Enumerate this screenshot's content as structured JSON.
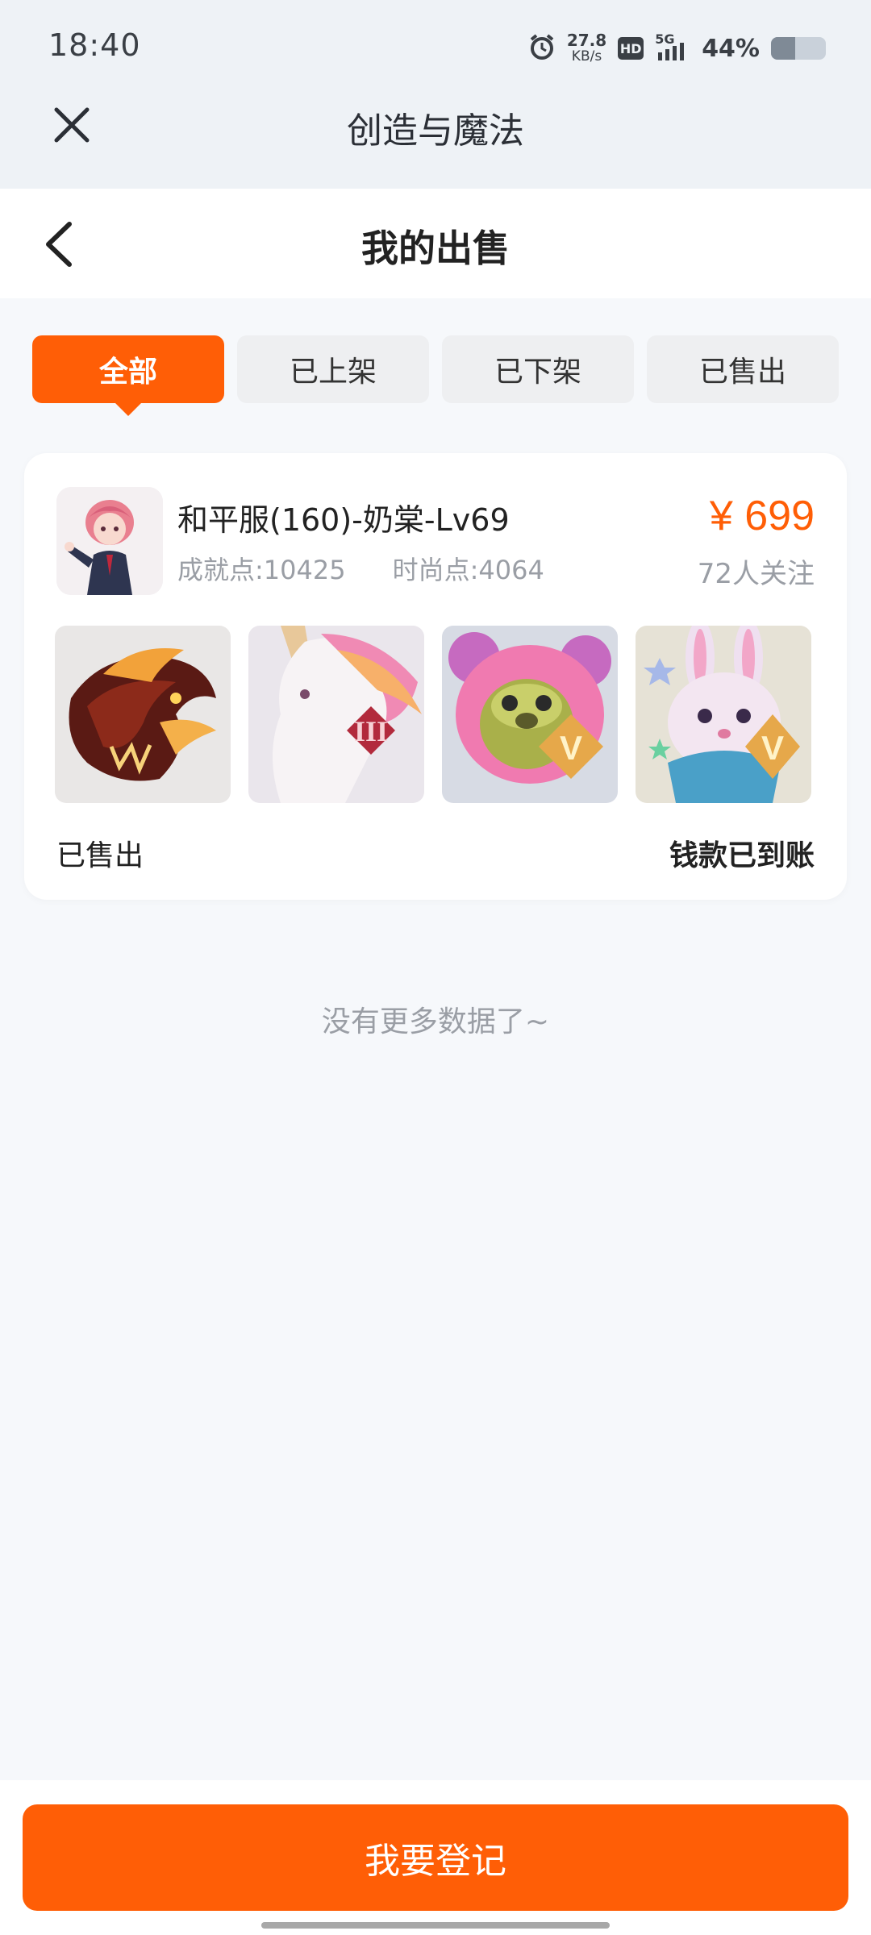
{
  "status_bar": {
    "time": "18:40",
    "net_speed_value": "27.8",
    "net_speed_unit": "KB/s",
    "hd_badge": "HD",
    "signal_label": "5G",
    "battery_percent_text": "44%",
    "battery_level": 0.44
  },
  "app_header": {
    "title": "创造与魔法"
  },
  "page_header": {
    "title": "我的出售"
  },
  "tabs": [
    {
      "label": "全部",
      "active": true
    },
    {
      "label": "已上架",
      "active": false
    },
    {
      "label": "已下架",
      "active": false
    },
    {
      "label": "已售出",
      "active": false
    }
  ],
  "listing": {
    "title": "和平服(160)-奶棠-Lv69",
    "achievement_points": "成就点:10425",
    "fashion_points": "时尚点:4064",
    "price": "¥ 699",
    "followers": "72人关注",
    "items": [
      {
        "icon": "dragon-mount-icon",
        "badge": ""
      },
      {
        "icon": "unicorn-mount-icon",
        "badge": "III"
      },
      {
        "icon": "pink-bear-costume-icon",
        "badge": "V"
      },
      {
        "icon": "bunny-pet-icon",
        "badge": "V"
      }
    ],
    "status": "已售出",
    "payment_status": "钱款已到账"
  },
  "footer_hint": "没有更多数据了~",
  "bottom": {
    "register_label": "我要登记"
  },
  "colors": {
    "accent": "#ff5e06",
    "page_bg": "#f6f8fb",
    "header_bg": "#eef2f6"
  }
}
